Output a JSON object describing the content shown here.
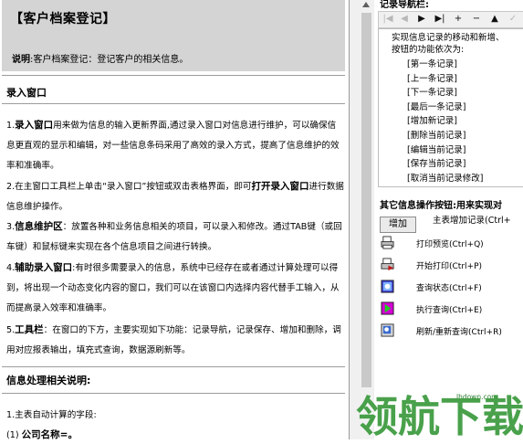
{
  "help": {
    "title": "【客户档案登记】",
    "desc_label": "说明",
    "desc_text": ":客户档案登记：登记客户的相关信息。",
    "section1_title": "录入窗口",
    "p1_num": "1.",
    "p1_bold": "录入窗口",
    "p1_text": "用来做为信息的输入更新界面,通过录入窗口对信息进行维护，可以确保信息更直观的显示和编辑，对一些信息条码采用了高效的录入方式，提高了信息维护的效率和准确率。",
    "p2_text_a": "2.在主窗口工具栏上单击“录入窗口”按钮或双击表格界面，即可",
    "p2_bold": "打开录入窗口",
    "p2_text_b": "进行数据信息维护操作。",
    "p3_num": "3.",
    "p3_bold": "信息维护区",
    "p3_text": "：放置各种和业务信息相关的项目，可以录入和修改。通过TAB键（或回车键）和鼠标键来实现在各个信息项目之间进行转换。",
    "p4_num": "4.",
    "p4_bold": "辅助录入窗口",
    "p4_text": ":有时很多需要录入的信息，系统中已经存在或者通过计算处理可以得到，将出现一个动态变化内容的窗口，我们可以在该窗口内选择内容代替手工输入，从而提高录入效率和准确率。",
    "p5_num": "5.",
    "p5_bold": "工具栏",
    "p5_text": "：在窗口的下方，主要实现如下功能：记录导航，记录保存、增加和删除，调用对应报表输出，填充式查询，数据源刷新等。",
    "section2_title": "信息处理相关说明:",
    "p6_text": "1.主表自动计算的字段:",
    "p7_num": "(1)",
    "p7_bold": "公司名称=。"
  },
  "nav": {
    "title": "记录导航栏:",
    "buttons": [
      "|◀",
      "◀",
      "▶",
      "▶|",
      "+",
      "−",
      "▲",
      "✓"
    ],
    "desc_line1": "实现信息记录的移动和新增、",
    "desc_line2": "按钮的功能依次为:",
    "items": [
      "[第一条记录]",
      "[上一条记录]",
      "[下一条记录]",
      "[最后一条记录]",
      "[增加新记录]",
      "[删除当前记录]",
      "[编辑当前记录]",
      "[保存当前记录]",
      "[取消当前记录修改]"
    ]
  },
  "ops": {
    "title": "其它信息操作按钮:用来实现对",
    "add_button": "增加",
    "add_desc": "主表增加记录(Ctrl+",
    "items": [
      {
        "icon": "print-preview-icon",
        "label": "打印预览(Ctrl+Q)"
      },
      {
        "icon": "print-icon",
        "label": "开始打印(Ctrl+P)"
      },
      {
        "icon": "query-status-icon",
        "label": "查询状态(Ctrl+F)"
      },
      {
        "icon": "execute-query-icon",
        "label": "执行查询(Ctrl+E)"
      },
      {
        "icon": "refresh-query-icon",
        "label": "刷新/重新查询(Ctrl+R)"
      }
    ]
  },
  "watermark": {
    "text": "领航下载",
    "url": "lhdown.com"
  }
}
